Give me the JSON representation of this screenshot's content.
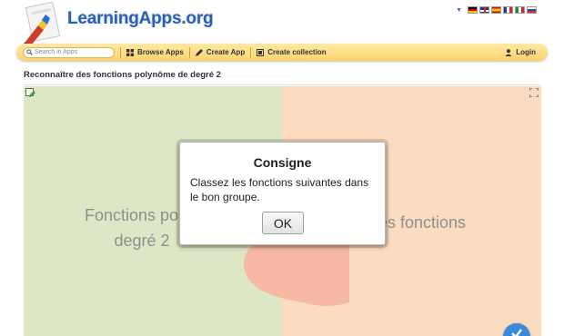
{
  "header": {
    "logo_text": "LearningApps.org",
    "languages": [
      "de",
      "en",
      "es",
      "fr",
      "it",
      "ru"
    ]
  },
  "nav": {
    "search_placeholder": "Search in Apps",
    "browse_label": "Browse Apps",
    "create_app_label": "Create App",
    "create_collection_label": "Create collection",
    "login_label": "Login"
  },
  "page": {
    "title": "Reconnaître des fonctions polynôme de degré 2"
  },
  "app": {
    "left_group_line1": "Fonctions polyn",
    "left_group_line2": "degré 2",
    "right_group_text": "es fonctions",
    "left_color": "#dde7c6",
    "right_color": "#fbdcc0"
  },
  "dialog": {
    "title": "Consigne",
    "message": "Classez les fonctions suivantes dans le bon groupe.",
    "ok_label": "OK"
  }
}
